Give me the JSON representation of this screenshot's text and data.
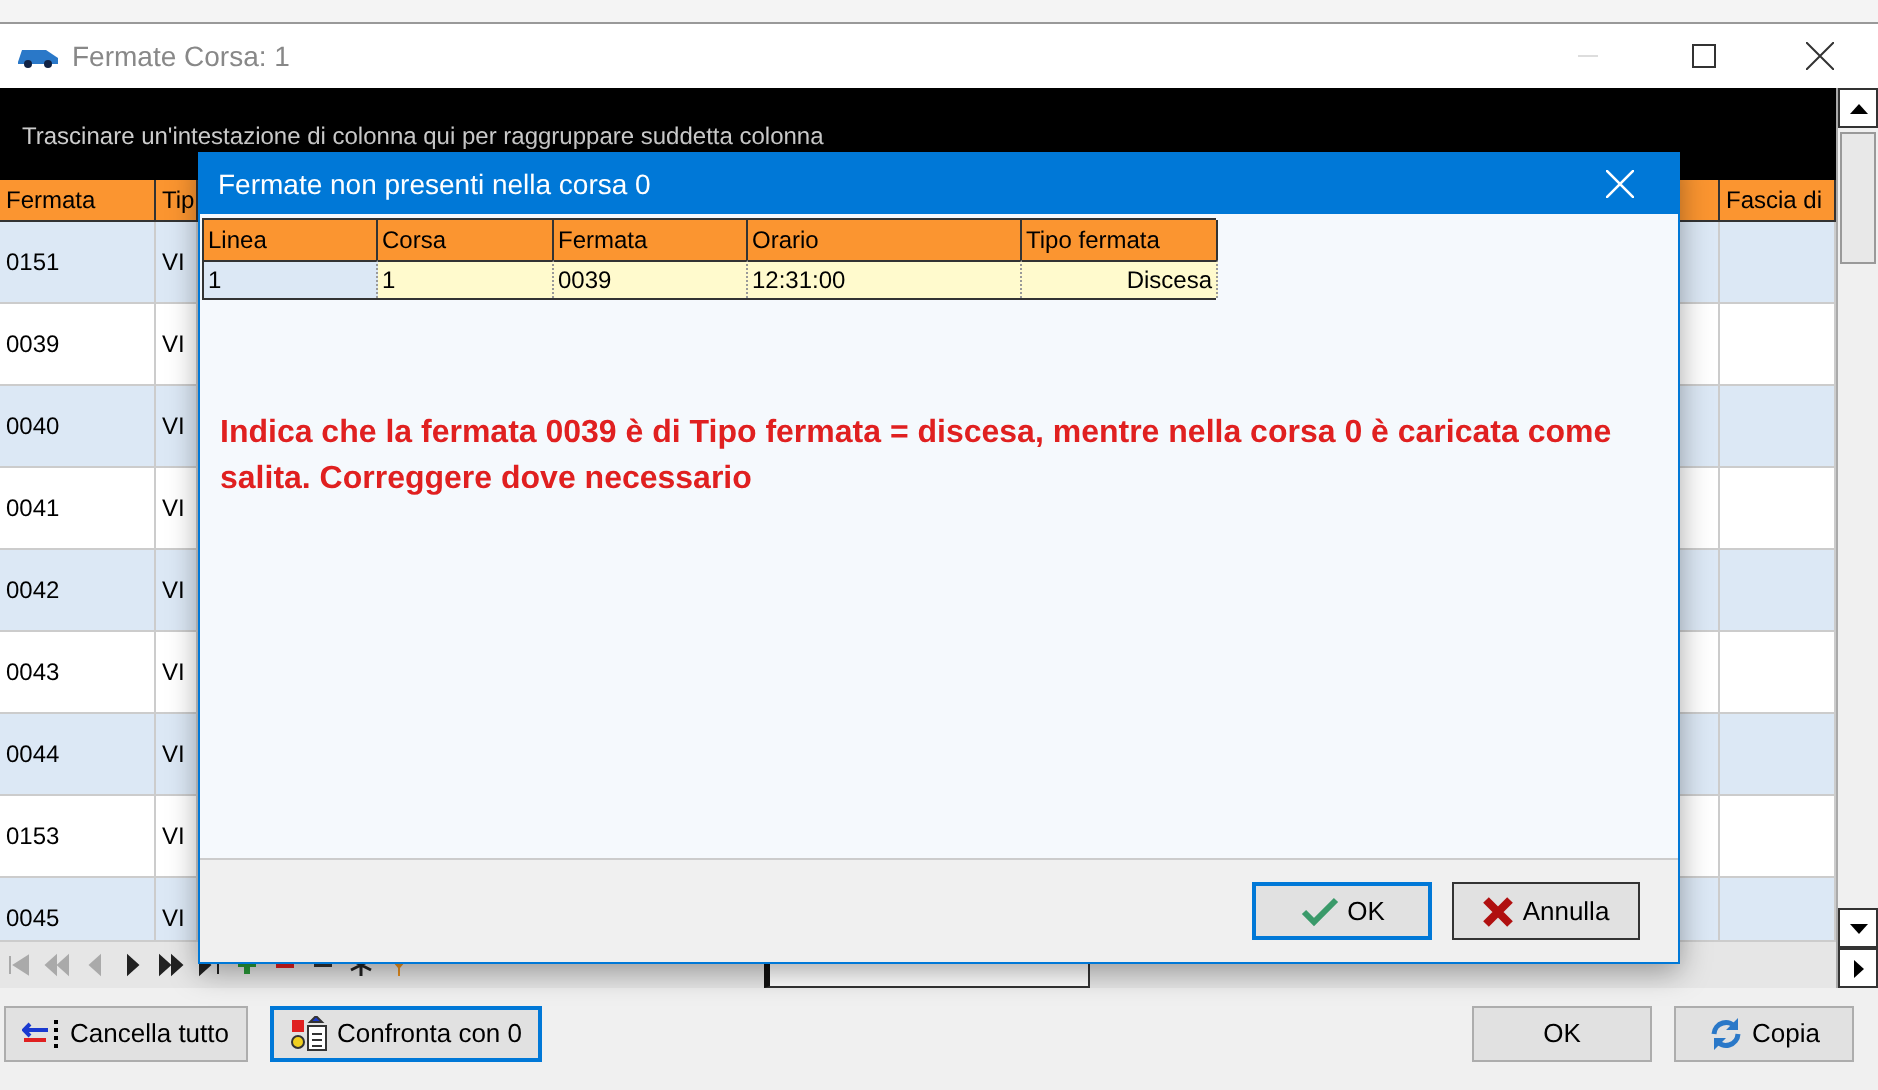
{
  "window": {
    "title": "Fermate Corsa: 1"
  },
  "group_panel": {
    "hint": "Trascinare un'intestazione di colonna qui per raggruppare suddetta colonna"
  },
  "grid": {
    "columns": [
      {
        "label": "Fermata"
      },
      {
        "label": "Tip"
      },
      {
        "label": "Fascia di"
      }
    ],
    "rows": [
      {
        "fermata": "0151",
        "tipo": "VI"
      },
      {
        "fermata": "0039",
        "tipo": "VI"
      },
      {
        "fermata": "0040",
        "tipo": "VI"
      },
      {
        "fermata": "0041",
        "tipo": "VI"
      },
      {
        "fermata": "0042",
        "tipo": "VI"
      },
      {
        "fermata": "0043",
        "tipo": "VI"
      },
      {
        "fermata": "0044",
        "tipo": "VI"
      },
      {
        "fermata": "0153",
        "tipo": "VI"
      },
      {
        "fermata": "0045",
        "tipo": "VI"
      }
    ]
  },
  "dialog": {
    "title": "Fermate non presenti nella corsa 0",
    "columns": [
      "Linea",
      "Corsa",
      "Fermata",
      "Orario",
      "Tipo fermata"
    ],
    "rows": [
      {
        "cells": [
          "1",
          "1",
          "0039",
          "12:31:00",
          "Discesa"
        ]
      }
    ],
    "message": "Indica che la fermata 0039 è di Tipo fermata = discesa, mentre nella corsa 0 è caricata come salita. Correggere dove necessario",
    "buttons": [
      {
        "label": "OK",
        "kind": "ok",
        "focused": true
      },
      {
        "label": "Annulla",
        "kind": "cancel",
        "focused": false
      }
    ]
  },
  "footer": {
    "buttons": [
      {
        "label": "Cancella tutto",
        "kind": "clear",
        "focused": false
      },
      {
        "label": "Confronta con 0",
        "kind": "compare",
        "focused": true
      },
      {
        "label": "OK",
        "kind": "plain",
        "focused": false
      },
      {
        "label": "Copia",
        "kind": "copy",
        "focused": false
      }
    ]
  }
}
